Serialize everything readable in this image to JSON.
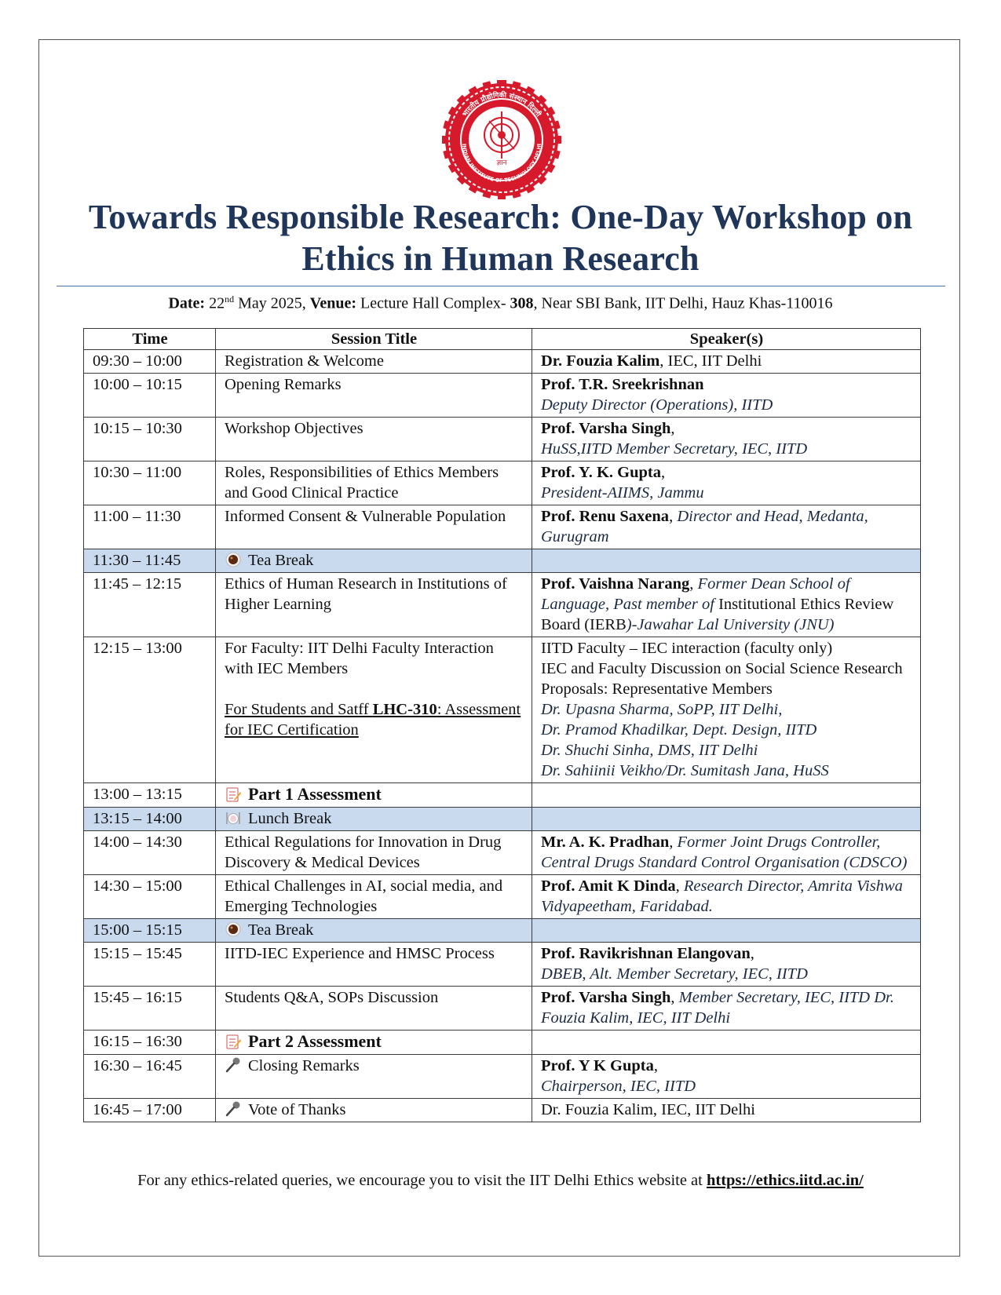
{
  "document": {
    "title_line1": "Towards Responsible Research: One-Day Workshop on",
    "title_line2": "Ethics in Human Research",
    "date_label": "Date:",
    "date_day": "22",
    "date_suffix": "nd",
    "date_rest": " May 2025,",
    "venue_label": "Venue:",
    "venue_text1": " Lecture Hall Complex- ",
    "venue_room": "308",
    "venue_text2": ", Near SBI Bank, IIT Delhi, Hauz Khas-110016"
  },
  "logo": {
    "text_hindi": "भारतीय प्रौद्योगिकी संस्थान दिल्ली",
    "text_english": "INDIAN INSTITUTE OF TECHNOLOGY DELHI",
    "motto": "ज्ञान",
    "color": "#d7192c"
  },
  "table": {
    "headers": {
      "time": "Time",
      "title": "Session Title",
      "speaker": "Speaker(s)"
    },
    "rows": [
      {
        "time": "09:30 – 10:00",
        "title": "Registration & Welcome",
        "sp_bold": "Dr. Fouzia Kalim",
        "sp_text": ", IEC, IIT Delhi"
      },
      {
        "time": "10:00 – 10:15",
        "title": "Opening Remarks",
        "sp_bold": "Prof. T.R. Sreekrishnan",
        "sp_italic": "Deputy Director (Operations), IITD"
      },
      {
        "time": "10:15 – 10:30",
        "title": "Workshop Objectives",
        "sp_bold": "Prof. Varsha Singh",
        "sp_text": ",",
        "sp_italic": "HuSS,IITD Member Secretary, IEC, IITD"
      },
      {
        "time": "10:30 – 11:00",
        "title": "Roles, Responsibilities of Ethics Members and Good Clinical Practice",
        "sp_bold": "Prof. Y. K. Gupta",
        "sp_text": ",",
        "sp_italic": "President-AIIMS, Jammu"
      },
      {
        "time": "11:00 – 11:30",
        "title": "Informed Consent & Vulnerable Population",
        "sp_bold": "Prof. Renu Saxena",
        "sp_text": ", ",
        "sp_italic": "Director and Head, Medanta, Gurugram"
      },
      {
        "time": "11:30 – 11:45",
        "title": "Tea Break",
        "icon": "tea-icon"
      },
      {
        "time": "11:45 – 12:15",
        "title": "Ethics of Human Research in Institutions of Higher Learning",
        "sp_bold": "Prof. Vaishna Narang",
        "sp_text": ", ",
        "sp_italic": "Former Dean School of Language, Past member of ",
        "sp_text2": "Institutional Ethics Review Board (IERB",
        "sp_italic2": ")-Jawahar Lal University (JNU)"
      },
      {
        "time": "12:15 – 13:00",
        "title": "For Faculty: IIT Delhi Faculty Interaction with IEC Members",
        "title2_u": "For Students and Satff ",
        "title2_bold": "LHC-310",
        "title2_rest": ": Assessment for IEC Certification",
        "sp_lines": [
          "IITD Faculty – IEC interaction (faculty only)",
          "IEC and Faculty Discussion on Social Science Research Proposals: Representative Members"
        ],
        "sp_italic_lines": [
          "Dr. Upasna Sharma, SoPP, IIT Delhi,",
          "Dr. Pramod Khadilkar, Dept. Design, IITD",
          "Dr. Shuchi Sinha, DMS, IIT Delhi",
          "Dr. Sahiinii Veikho/Dr. Sumitash Jana, HuSS"
        ]
      },
      {
        "time": "13:00 – 13:15",
        "title": "Part 1 Assessment",
        "icon": "memo-icon"
      },
      {
        "time": "13:15 – 14:00",
        "title": "Lunch Break",
        "icon": "plate-icon"
      },
      {
        "time": "14:00 – 14:30",
        "title": "Ethical Regulations for Innovation in Drug Discovery & Medical Devices",
        "sp_bold": "Mr. A. K. Pradhan",
        "sp_text": ", ",
        "sp_italic": "Former Joint Drugs Controller, Central Drugs Standard Control Organisation (CDSCO)"
      },
      {
        "time": "14:30 – 15:00",
        "title": "Ethical Challenges in AI, social media, and Emerging Technologies",
        "sp_bold": "Prof. Amit K Dinda",
        "sp_text": ", ",
        "sp_italic": "Research Director, Amrita Vishwa Vidyapeetham, Faridabad."
      },
      {
        "time": "15:00 – 15:15",
        "title": "Tea Break",
        "icon": "tea-icon"
      },
      {
        "time": "15:15 – 15:45",
        "title": "IITD-IEC Experience and HMSC Process",
        "sp_bold": "Prof. Ravikrishnan Elangovan",
        "sp_text": ",",
        "sp_italic": "DBEB, Alt. Member Secretary, IEC, IITD"
      },
      {
        "time": "15:45 – 16:15",
        "title": "Students Q&A, SOPs Discussion",
        "sp_bold": "Prof. Varsha Singh",
        "sp_text": ", ",
        "sp_italic": "Member Secretary, IEC, IITD Dr. Fouzia Kalim, IEC, IIT Delhi"
      },
      {
        "time": "16:15 – 16:30",
        "title": "Part 2 Assessment",
        "icon": "memo-icon"
      },
      {
        "time": "16:30 – 16:45",
        "title": "Closing Remarks",
        "icon": "microphone-icon",
        "sp_bold": "Prof. Y K Gupta",
        "sp_text": ",",
        "sp_italic": "Chairperson, IEC, IITD"
      },
      {
        "time": "16:45 – 17:00",
        "title": "Vote of Thanks",
        "icon": "microphone-icon",
        "sp_text": "Dr. Fouzia Kalim, IEC, IIT Delhi"
      }
    ]
  },
  "footer": {
    "text": "For any ethics-related queries, we encourage you to visit the IIT Delhi Ethics website at ",
    "link": "https://ethics.iitd.ac.in/"
  }
}
